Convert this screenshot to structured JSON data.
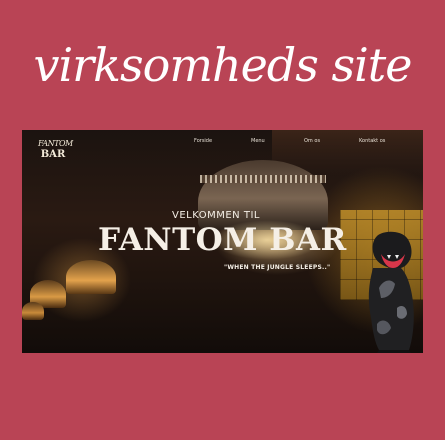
{
  "headline": "virksomheds site",
  "site": {
    "logo": {
      "line1": "FANTOM",
      "line2": "BAR"
    },
    "nav": [
      {
        "label": "Forside"
      },
      {
        "label": "Menu"
      },
      {
        "label": "Om os"
      },
      {
        "label": "Kontakt os"
      }
    ],
    "hero": {
      "welcome": "VELKOMMEN TIL",
      "title": "FANTOM BAR",
      "tagline": "\"WHEN THE JUNGLE SLEEPS..\""
    }
  },
  "colors": {
    "page_background": "#b94455",
    "hero_text": "#f5efe6"
  }
}
